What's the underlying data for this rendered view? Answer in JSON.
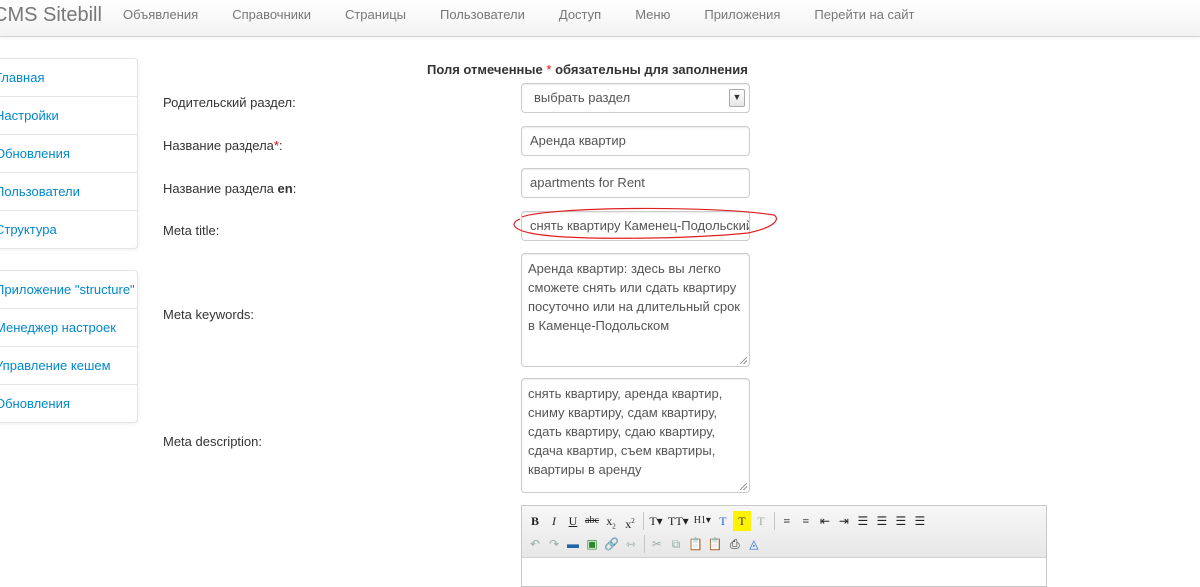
{
  "navbar": {
    "brand": "CMS Sitebill",
    "items": [
      "Объявления",
      "Справочники",
      "Страницы",
      "Пользователи",
      "Доступ",
      "Меню",
      "Приложения",
      "Перейти на сайт"
    ]
  },
  "sidebar": {
    "group1": [
      "Главная",
      "Настройки",
      "Обновления",
      "Пользователи",
      "Структура"
    ],
    "group2": [
      "Приложение \"structure\"",
      "Менеджер настроек",
      "Управление кешем",
      "Обновления"
    ]
  },
  "form": {
    "title_part1": "Поля отмеченные",
    "title_star": "*",
    "title_part2": "обязательны для заполнения",
    "parent_label": "Родительский раздел:",
    "parent_value": "выбрать раздел",
    "name_label": "Название раздела",
    "name_star": "*",
    "name_colon": ":",
    "name_value": "Аренда квартир",
    "name_en_label": "Название раздела",
    "name_en_suffix": "en",
    "name_en_colon": ":",
    "name_en_value": "apartments for Rent",
    "meta_title_label": "Meta title:",
    "meta_title_value": "снять квартиру Каменец-Подольский",
    "meta_keywords_label": "Meta keywords:",
    "meta_keywords_value": "Аренда квартир: здесь вы легко сможете снять или сдать квартиру посуточно или на длительный срок в Каменце-Подольском",
    "meta_description_label": "Meta description:",
    "meta_description_value": "снять квартиру, аренда квартир, сниму квартиру, сдам квартиру, сдать квартиру, сдаю квартиру, сдача квартир, съем квартиры, квартиры в аренду"
  },
  "colors": {
    "link": "#0088cc",
    "required": "#e00000",
    "annotation": "#e02020"
  }
}
